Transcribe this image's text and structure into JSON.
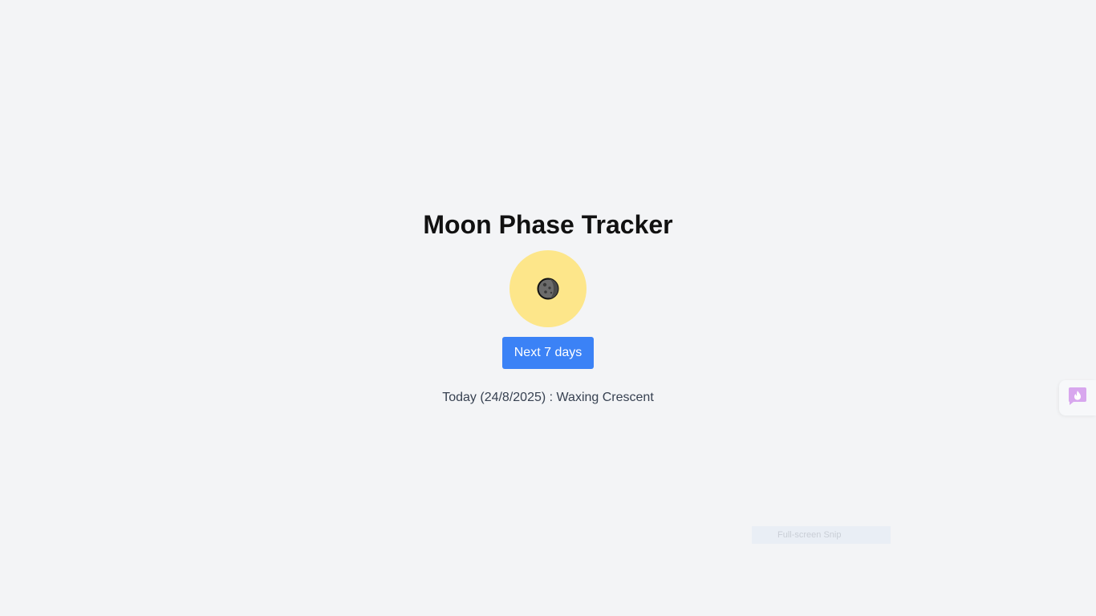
{
  "app": {
    "title": "Moon Phase Tracker"
  },
  "moon": {
    "icon": "moon-icon",
    "background_color": "#fde68a"
  },
  "controls": {
    "next_button_label": "Next 7 days",
    "accent_color": "#3b82f6"
  },
  "status": {
    "today_text": "Today (24/8/2025) : Waxing Crescent"
  },
  "overlay": {
    "snip_label": "Full-screen Snip",
    "side_widget_icon": "chat-flame-icon"
  }
}
